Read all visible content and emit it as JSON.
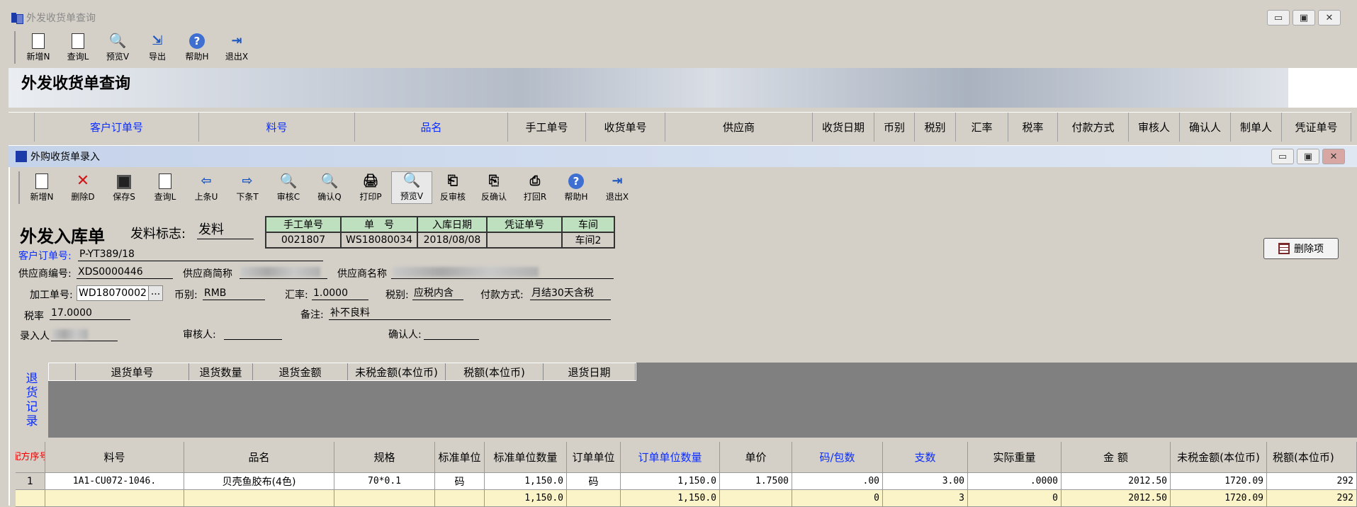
{
  "outer_window": {
    "title": "外发收货单查询",
    "toolbar": [
      {
        "label": "新增N",
        "icon": "new-doc-icon"
      },
      {
        "label": "查询L",
        "icon": "query-doc-icon"
      },
      {
        "label": "预览V",
        "icon": "preview-magnifier-icon"
      },
      {
        "label": "导出",
        "icon": "export-icon"
      },
      {
        "label": "帮助H",
        "icon": "help-icon"
      },
      {
        "label": "退出X",
        "icon": "exit-icon"
      }
    ],
    "banner_title": "外发收货单查询",
    "grid_columns": [
      "客户订单号",
      "料号",
      "品名",
      "手工单号",
      "收货单号",
      "供应商",
      "收货日期",
      "币别",
      "税别",
      "汇率",
      "税率",
      "付款方式",
      "审核人",
      "确认人",
      "制单人",
      "凭证单号"
    ]
  },
  "inner_window": {
    "title": "外购收货单录入",
    "toolbar": [
      {
        "label": "新增N",
        "icon": "new-doc-icon"
      },
      {
        "label": "删除D",
        "icon": "delete-x-icon"
      },
      {
        "label": "保存S",
        "icon": "save-disk-icon"
      },
      {
        "label": "查询L",
        "icon": "query-doc-icon"
      },
      {
        "label": "上条U",
        "icon": "arrow-left-icon"
      },
      {
        "label": "下条T",
        "icon": "arrow-right-icon"
      },
      {
        "label": "审核C",
        "icon": "audit-magnifier-icon"
      },
      {
        "label": "确认Q",
        "icon": "confirm-magnifier-icon"
      },
      {
        "label": "打印P",
        "icon": "print-icon"
      },
      {
        "label": "预览V",
        "icon": "preview-magnifier-icon"
      },
      {
        "label": "反审核",
        "icon": "unaudit-icon"
      },
      {
        "label": "反确认",
        "icon": "unconfirm-icon"
      },
      {
        "label": "打回R",
        "icon": "return-back-icon"
      },
      {
        "label": "帮助H",
        "icon": "help-icon"
      },
      {
        "label": "退出X",
        "icon": "exit-icon"
      }
    ],
    "form_title": "外发入库单",
    "issue_flag_label": "发料标志:",
    "issue_flag_value": "发料",
    "info_table": {
      "headers": [
        "手工单号",
        "单　号",
        "入库日期",
        "凭证单号",
        "车间"
      ],
      "values": [
        "0021807",
        "WS18080034",
        "2018/08/08",
        "",
        "车间2"
      ]
    },
    "delete_item_label": "删除项",
    "fields": {
      "customer_order_label": "客户订单号:",
      "customer_order_value": "P-YT389/18",
      "supplier_code_label": "供应商编号:",
      "supplier_code_value": "XDS0000446",
      "supplier_short_label": "供应商简称",
      "supplier_name_label": "供应商名称",
      "process_no_label": "加工单号:",
      "process_no_value": "WD18070002",
      "browse_label": "...",
      "currency_label": "币别:",
      "currency_value": "RMB",
      "rate_label": "汇率:",
      "rate_value": "1.0000",
      "tax_type_label": "税别:",
      "tax_type_value": "应税内含",
      "payment_label": "付款方式:",
      "payment_value": "月结30天含税",
      "tax_rate_label": "税率",
      "tax_rate_value": "17.0000",
      "remark_label": "备注:",
      "remark_value": "补不良料",
      "entry_label": "录入人",
      "auditor_label": "审核人:",
      "confirmer_label": "确认人:"
    },
    "return_side_label": [
      "退",
      "货",
      "记",
      "录"
    ],
    "return_columns": [
      "退货单号",
      "退货数量",
      "退货金额",
      "未税金额(本位币)",
      "税额(本位币)",
      "退货日期"
    ],
    "detail_columns": [
      "料号",
      "品名",
      "规格",
      "标准单位",
      "标准单位数量",
      "订单单位",
      "订单单位数量",
      "单价",
      "码/包数",
      "支数",
      "实际重量",
      "金  额",
      "未税金额(本位币)",
      "税额(本位币)"
    ],
    "detail_seq_header": "配方序号",
    "detail_rows": [
      {
        "no": "1",
        "item": "1A1-CU072-1046.",
        "name": "贝壳鱼胶布(4色)",
        "spec": "70*0.1",
        "std_unit": "码",
        "std_qty": "1,150.0",
        "ord_unit": "码",
        "ord_qty": "1,150.0",
        "price": "1.7500",
        "per_pack": ".00",
        "count": "3.00",
        "weight": ".0000",
        "amount": "2012.50",
        "net": "1720.09",
        "tax": "292"
      },
      {
        "no": "",
        "item": "",
        "name": "",
        "spec": "",
        "std_unit": "",
        "std_qty": "1,150.0",
        "ord_unit": "",
        "ord_qty": "1,150.0",
        "price": "",
        "per_pack": "0",
        "count": "3",
        "weight": "0",
        "amount": "2012.50",
        "net": "1720.09",
        "tax": "292"
      }
    ]
  }
}
